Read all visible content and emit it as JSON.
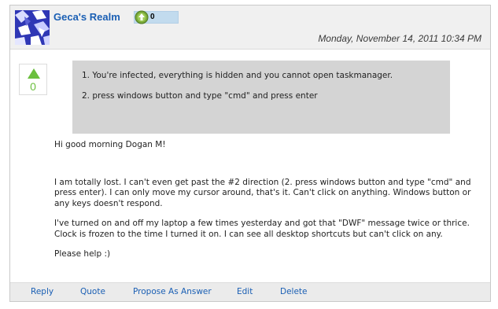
{
  "post": {
    "author": "Geca's Realm",
    "points": "0",
    "date": "Monday, November 14, 2011 10:34 PM",
    "vote_count": "0",
    "quote_lines": [
      "1. You're infected, everything is hidden and you cannot open taskmanager.",
      "2. press windows button and type \"cmd\" and press enter"
    ],
    "greeting": "Hi good morning Dogan M!",
    "paragraphs": [
      "I am totally lost. I can't even get past the #2 direction (2. press windows button and type \"cmd\" and press enter). I can only move my cursor around, that's it. Can't click on anything. Windows button or any keys doesn't respond.",
      "I've turned on and off my laptop a few times yesterday and got that \"DWF\" message twice or thrice. Clock is frozen to the time I turned it on. I can see all desktop shortcuts but can't click on any.",
      "Please help :)"
    ]
  },
  "actions": {
    "reply": "Reply",
    "quote": "Quote",
    "propose": "Propose As Answer",
    "edit": "Edit",
    "delete": "Delete"
  },
  "icons": {
    "avatar": "avatar-pattern-icon",
    "medal": "medal-arrow-icon",
    "vote": "vote-up-arrow-icon"
  },
  "colors": {
    "link": "#1a5fb4",
    "vote_green": "#6bbf3e",
    "avatar_blue": "#2f37b5",
    "quote_bg": "#d4d4d4"
  }
}
